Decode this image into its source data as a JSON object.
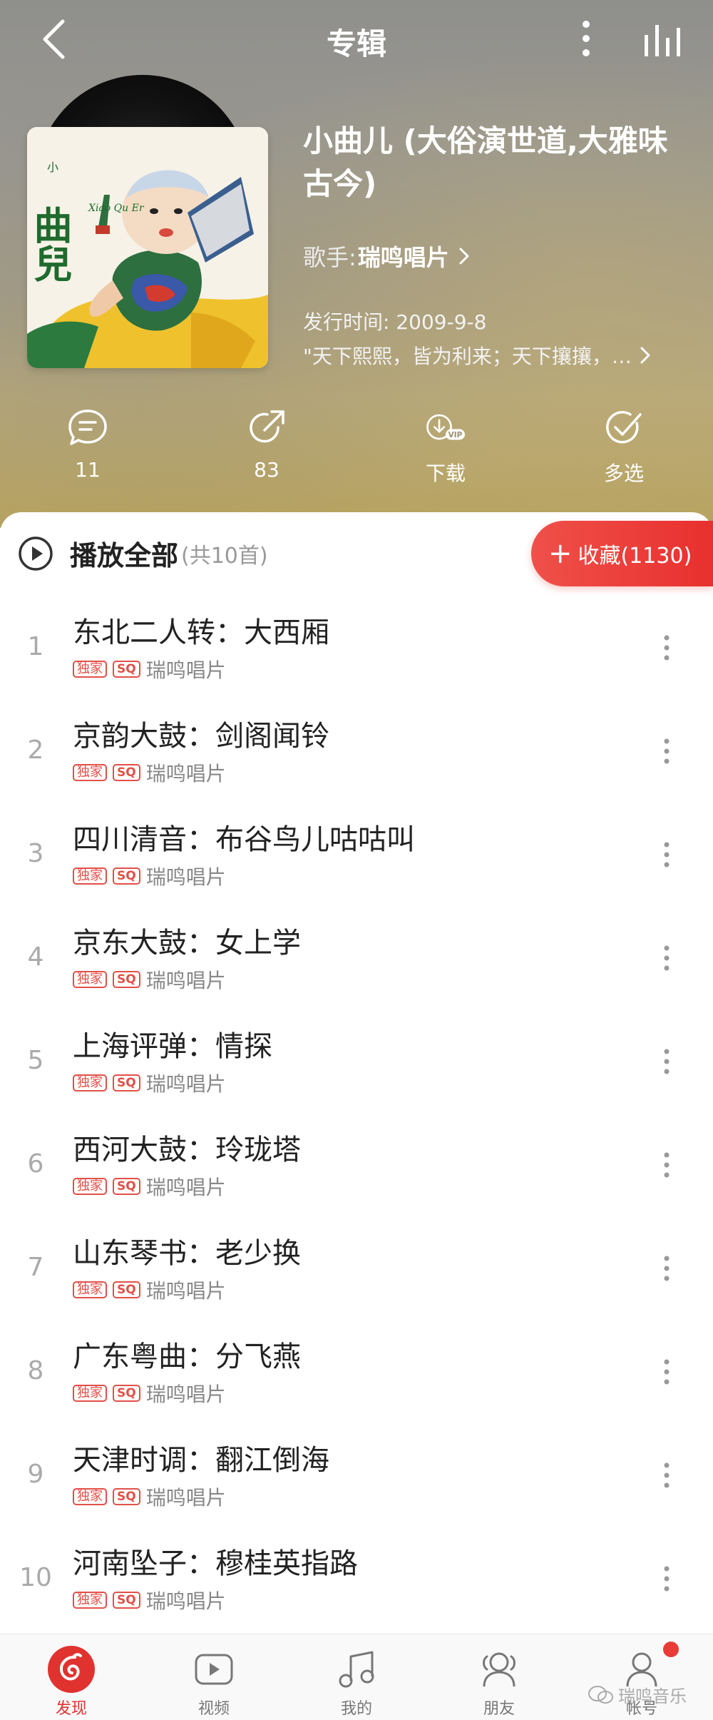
{
  "header": {
    "title": "专辑"
  },
  "album": {
    "title": "小曲儿 (大俗演世道,大雅味古今)",
    "artist_label": "歌手:",
    "artist_name": "瑞鸣唱片",
    "release_date": "发行时间: 2009-9-8",
    "description": "\"天下熙熙，皆为利来；天下攘攘，…",
    "cover": {
      "text": "曲兒",
      "text_small": "小",
      "subtitle": "Xiao Qu Er"
    }
  },
  "actions": [
    {
      "label": "11",
      "icon": "comment-icon"
    },
    {
      "label": "83",
      "icon": "share-icon"
    },
    {
      "label": "下载",
      "icon": "download-vip-icon",
      "badge": "VIP"
    },
    {
      "label": "多选",
      "icon": "multiselect-icon"
    }
  ],
  "playall": {
    "label": "播放全部",
    "count": "(共10首)"
  },
  "collect": {
    "label": "收藏(1130)"
  },
  "badges": {
    "exclusive": "独家",
    "sq": "SQ"
  },
  "songs": [
    {
      "num": "1",
      "title": "东北二人转：大西厢",
      "artist": "瑞鸣唱片"
    },
    {
      "num": "2",
      "title": "京韵大鼓：剑阁闻铃",
      "artist": "瑞鸣唱片"
    },
    {
      "num": "3",
      "title": "四川清音：布谷鸟儿咕咕叫",
      "artist": "瑞鸣唱片"
    },
    {
      "num": "4",
      "title": "京东大鼓：女上学",
      "artist": "瑞鸣唱片"
    },
    {
      "num": "5",
      "title": "上海评弹：情探",
      "artist": "瑞鸣唱片"
    },
    {
      "num": "6",
      "title": "西河大鼓：玲珑塔",
      "artist": "瑞鸣唱片"
    },
    {
      "num": "7",
      "title": "山东琴书：老少换",
      "artist": "瑞鸣唱片"
    },
    {
      "num": "8",
      "title": "广东粤曲：分飞燕",
      "artist": "瑞鸣唱片"
    },
    {
      "num": "9",
      "title": "天津时调：翻江倒海",
      "artist": "瑞鸣唱片"
    },
    {
      "num": "10",
      "title": "河南坠子：穆桂英指路",
      "artist": "瑞鸣唱片"
    }
  ],
  "tabs": [
    {
      "label": "发现",
      "icon": "discover-icon",
      "active": true
    },
    {
      "label": "视频",
      "icon": "video-icon"
    },
    {
      "label": "我的",
      "icon": "music-note-icon"
    },
    {
      "label": "朋友",
      "icon": "friends-icon"
    },
    {
      "label": "帐号",
      "icon": "account-icon",
      "notification": true
    }
  ],
  "watermark": {
    "text": "瑞鸣音乐"
  },
  "colors": {
    "accent": "#e0332f",
    "badge": "#e25048"
  }
}
